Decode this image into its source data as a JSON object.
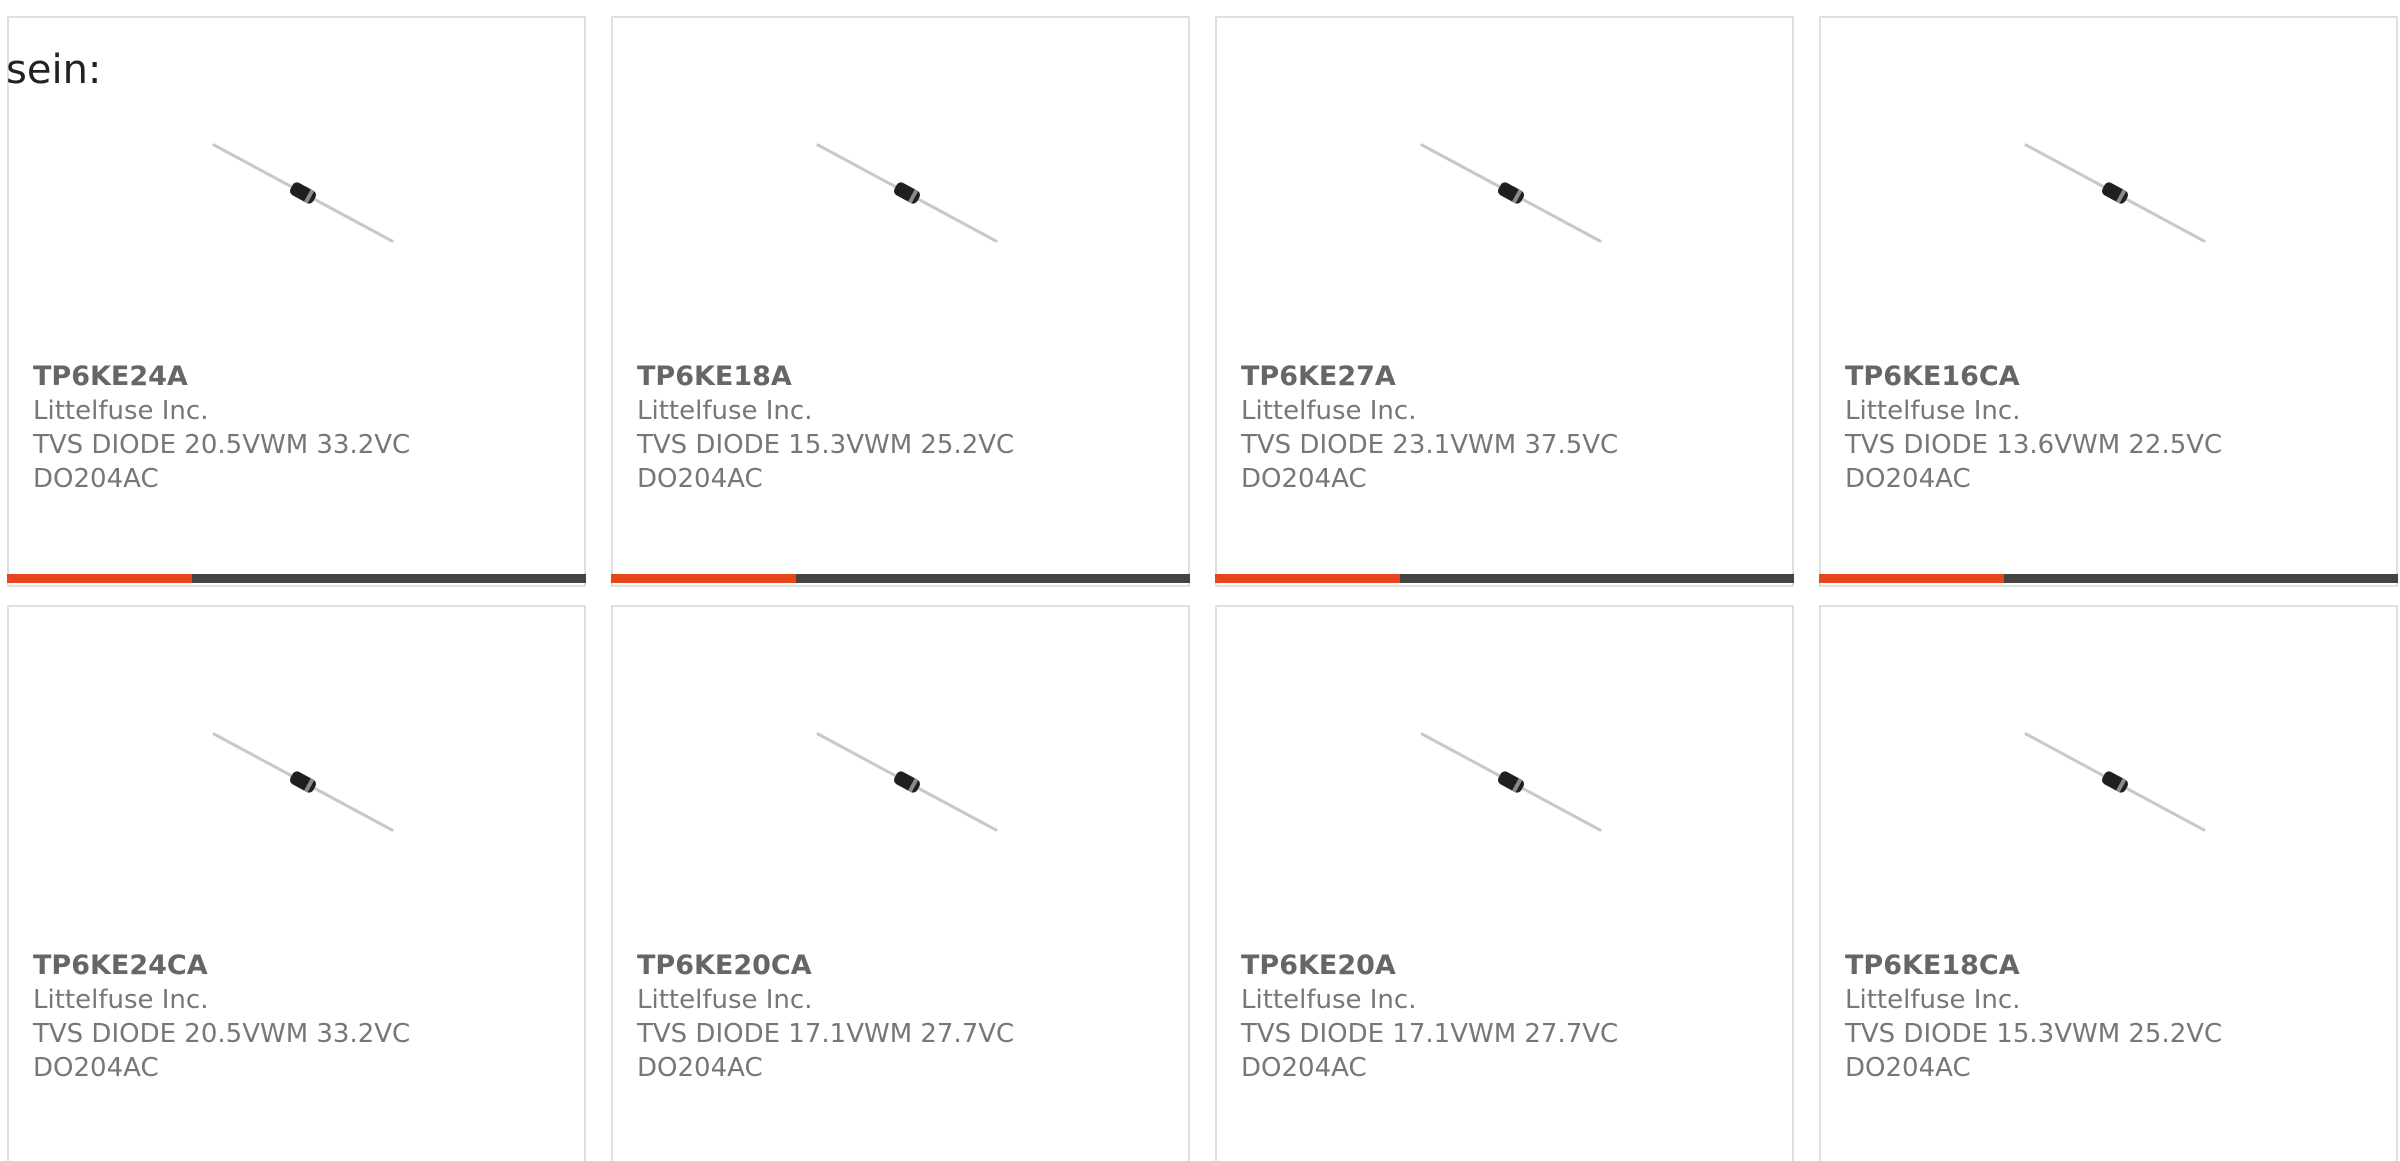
{
  "intro_text": "sein:",
  "accent_color": "#e8461a",
  "bar_track_color": "#444444",
  "products": [
    {
      "part": "TP6KE24A",
      "manufacturer": "Littelfuse Inc.",
      "description": "TVS DIODE 20.5VWM 33.2VC",
      "package": "DO204AC",
      "image_icon": "axial-diode-icon",
      "progress": 0.32
    },
    {
      "part": "TP6KE18A",
      "manufacturer": "Littelfuse Inc.",
      "description": "TVS DIODE 15.3VWM 25.2VC",
      "package": "DO204AC",
      "image_icon": "axial-diode-icon",
      "progress": 0.32
    },
    {
      "part": "TP6KE27A",
      "manufacturer": "Littelfuse Inc.",
      "description": "TVS DIODE 23.1VWM 37.5VC",
      "package": "DO204AC",
      "image_icon": "axial-diode-icon",
      "progress": 0.32
    },
    {
      "part": "TP6KE16CA",
      "manufacturer": "Littelfuse Inc.",
      "description": "TVS DIODE 13.6VWM 22.5VC",
      "package": "DO204AC",
      "image_icon": "axial-diode-icon",
      "progress": 0.32
    },
    {
      "part": "TP6KE24CA",
      "manufacturer": "Littelfuse Inc.",
      "description": "TVS DIODE 20.5VWM 33.2VC",
      "package": "DO204AC",
      "image_icon": "axial-diode-icon"
    },
    {
      "part": "TP6KE20CA",
      "manufacturer": "Littelfuse Inc.",
      "description": "TVS DIODE 17.1VWM 27.7VC",
      "package": "DO204AC",
      "image_icon": "axial-diode-icon"
    },
    {
      "part": "TP6KE20A",
      "manufacturer": "Littelfuse Inc.",
      "description": "TVS DIODE 17.1VWM 27.7VC",
      "package": "DO204AC",
      "image_icon": "axial-diode-icon"
    },
    {
      "part": "TP6KE18CA",
      "manufacturer": "Littelfuse Inc.",
      "description": "TVS DIODE 15.3VWM 25.2VC",
      "package": "DO204AC",
      "image_icon": "axial-diode-icon"
    }
  ]
}
